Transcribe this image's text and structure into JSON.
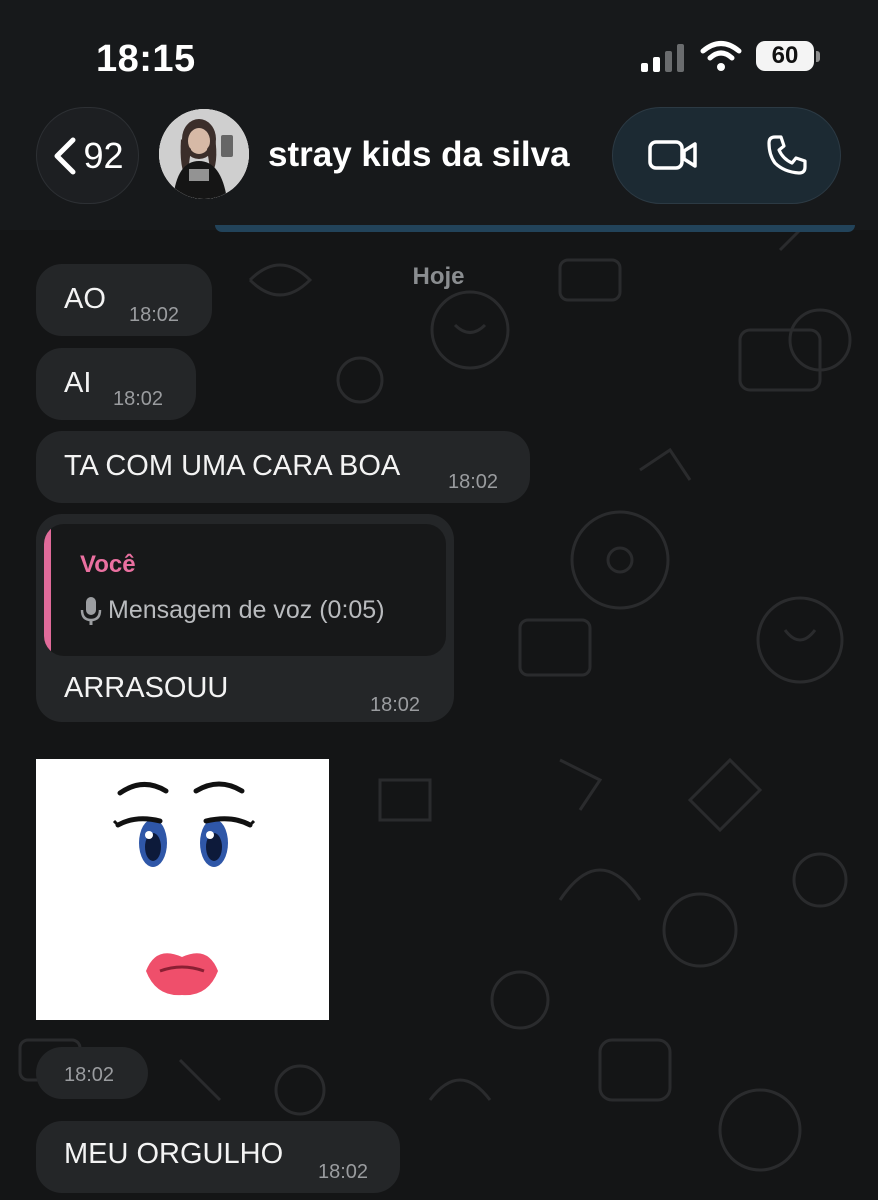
{
  "status_bar": {
    "time": "18:15",
    "battery_level": "60"
  },
  "header": {
    "back_count": "92",
    "contact_name": "stray kids da silva",
    "video_icon": "video-camera-icon",
    "phone_icon": "phone-icon"
  },
  "chat": {
    "date_label": "Hoje",
    "messages": [
      {
        "text": "AO",
        "time": "18:02"
      },
      {
        "text": "AI",
        "time": "18:02"
      },
      {
        "text": "TA COM UMA CARA BOA",
        "time": "18:02"
      },
      {
        "quote_author": "Você",
        "quote_text": "Mensagem de voz (0:05)",
        "text": "ARRASOUU",
        "time": "18:02"
      },
      {
        "type": "sticker",
        "time": "18:02"
      },
      {
        "text": "MEU ORGULHO",
        "time": "18:02"
      }
    ]
  },
  "colors": {
    "background": "#141516",
    "bubble": "#242628",
    "quote_accent": "#e06b9a",
    "header": "#17191b"
  }
}
